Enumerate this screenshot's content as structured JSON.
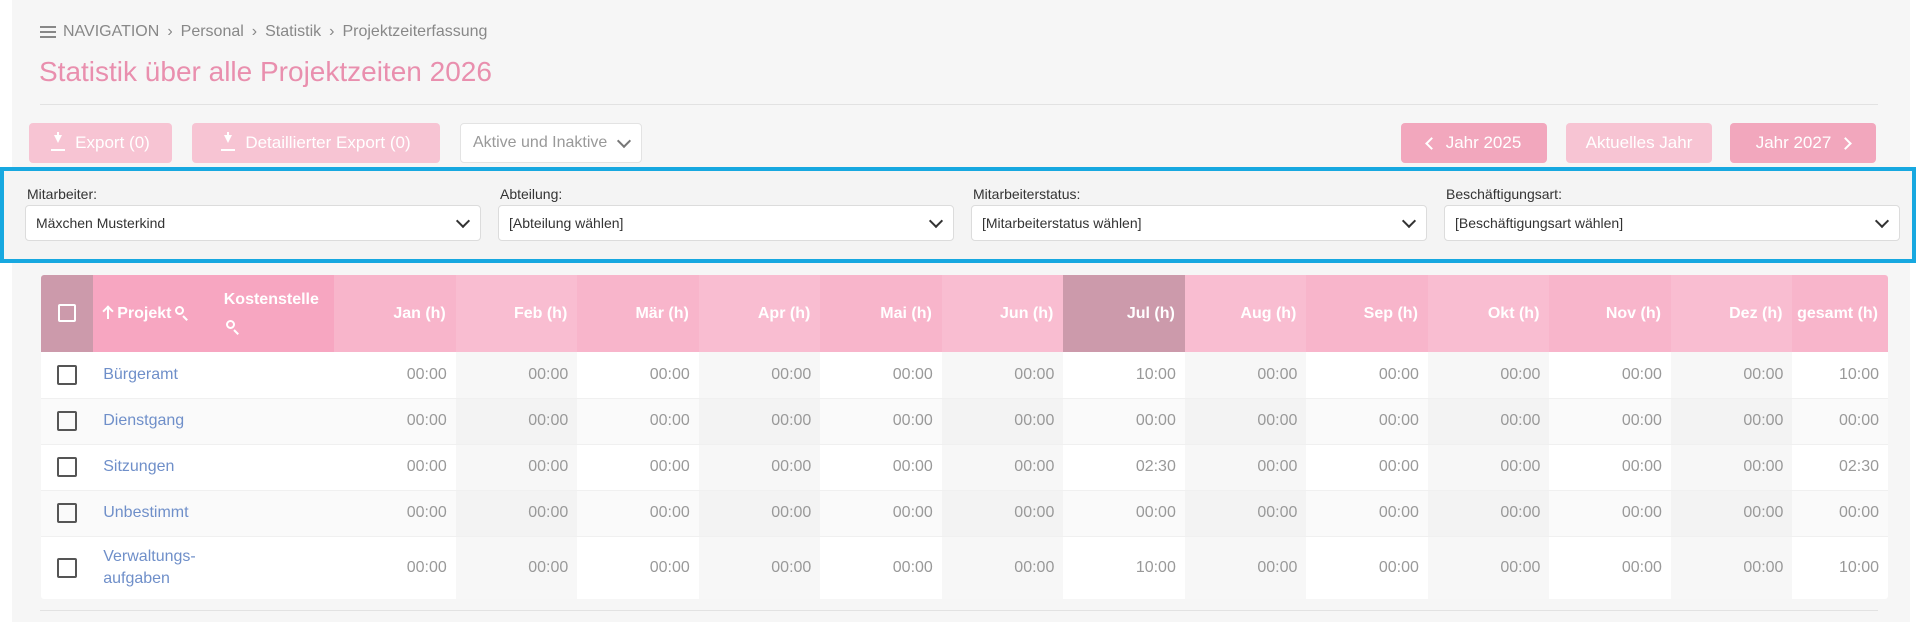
{
  "breadcrumb": {
    "nav_label": "NAVIGATION",
    "items": [
      "Personal",
      "Statistik",
      "Projektzeiterfassung"
    ]
  },
  "title": "Statistik über alle Projektzeiten 2026",
  "toolbar": {
    "export_label": "Export (0)",
    "detailed_export_label": "Detaillierter Export (0)",
    "active_filter_label": "Aktive und Inaktive",
    "prev_year_label": "Jahr 2025",
    "current_year_label": "Aktuelles Jahr",
    "next_year_label": "Jahr 2027"
  },
  "filters": {
    "employee": {
      "label": "Mitarbeiter:",
      "value": "Mäxchen Musterkind"
    },
    "department": {
      "label": "Abteilung:",
      "value": "[Abteilung wählen]"
    },
    "status": {
      "label": "Mitarbeiterstatus:",
      "value": "[Mitarbeiterstatus wählen]"
    },
    "employment": {
      "label": "Beschäftigungsart:",
      "value": "[Beschäftigungsart wählen]"
    }
  },
  "table": {
    "headers": {
      "project": "Projekt",
      "cost_center": "Kostenstelle",
      "months": [
        "Jan (h)",
        "Feb (h)",
        "Mär (h)",
        "Apr (h)",
        "Mai (h)",
        "Jun (h)",
        "Jul (h)",
        "Aug (h)",
        "Sep (h)",
        "Okt (h)",
        "Nov (h)",
        "Dez (h)"
      ],
      "total": "gesamt (h)"
    },
    "rows": [
      {
        "project": "Bürgeramt",
        "cost_center": "",
        "months": [
          "00:00",
          "00:00",
          "00:00",
          "00:00",
          "00:00",
          "00:00",
          "10:00",
          "00:00",
          "00:00",
          "00:00",
          "00:00",
          "00:00"
        ],
        "total": "10:00"
      },
      {
        "project": "Dienstgang",
        "cost_center": "",
        "months": [
          "00:00",
          "00:00",
          "00:00",
          "00:00",
          "00:00",
          "00:00",
          "00:00",
          "00:00",
          "00:00",
          "00:00",
          "00:00",
          "00:00"
        ],
        "total": "00:00"
      },
      {
        "project": "Sitzungen",
        "cost_center": "",
        "months": [
          "00:00",
          "00:00",
          "00:00",
          "00:00",
          "00:00",
          "00:00",
          "02:30",
          "00:00",
          "00:00",
          "00:00",
          "00:00",
          "00:00"
        ],
        "total": "02:30"
      },
      {
        "project": "Unbestimmt",
        "cost_center": "",
        "months": [
          "00:00",
          "00:00",
          "00:00",
          "00:00",
          "00:00",
          "00:00",
          "00:00",
          "00:00",
          "00:00",
          "00:00",
          "00:00",
          "00:00"
        ],
        "total": "00:00"
      },
      {
        "project": "Verwaltungs-\naufgaben",
        "cost_center": "",
        "months": [
          "00:00",
          "00:00",
          "00:00",
          "00:00",
          "00:00",
          "00:00",
          "10:00",
          "00:00",
          "00:00",
          "00:00",
          "00:00",
          "00:00"
        ],
        "total": "10:00"
      }
    ]
  },
  "colors": {
    "accent": "#e98fae",
    "header_pink": "#f8b5cb",
    "header_sorted": "#cc9aab",
    "filter_highlight": "#17a8e0",
    "link_blue": "#6f8fc9"
  }
}
